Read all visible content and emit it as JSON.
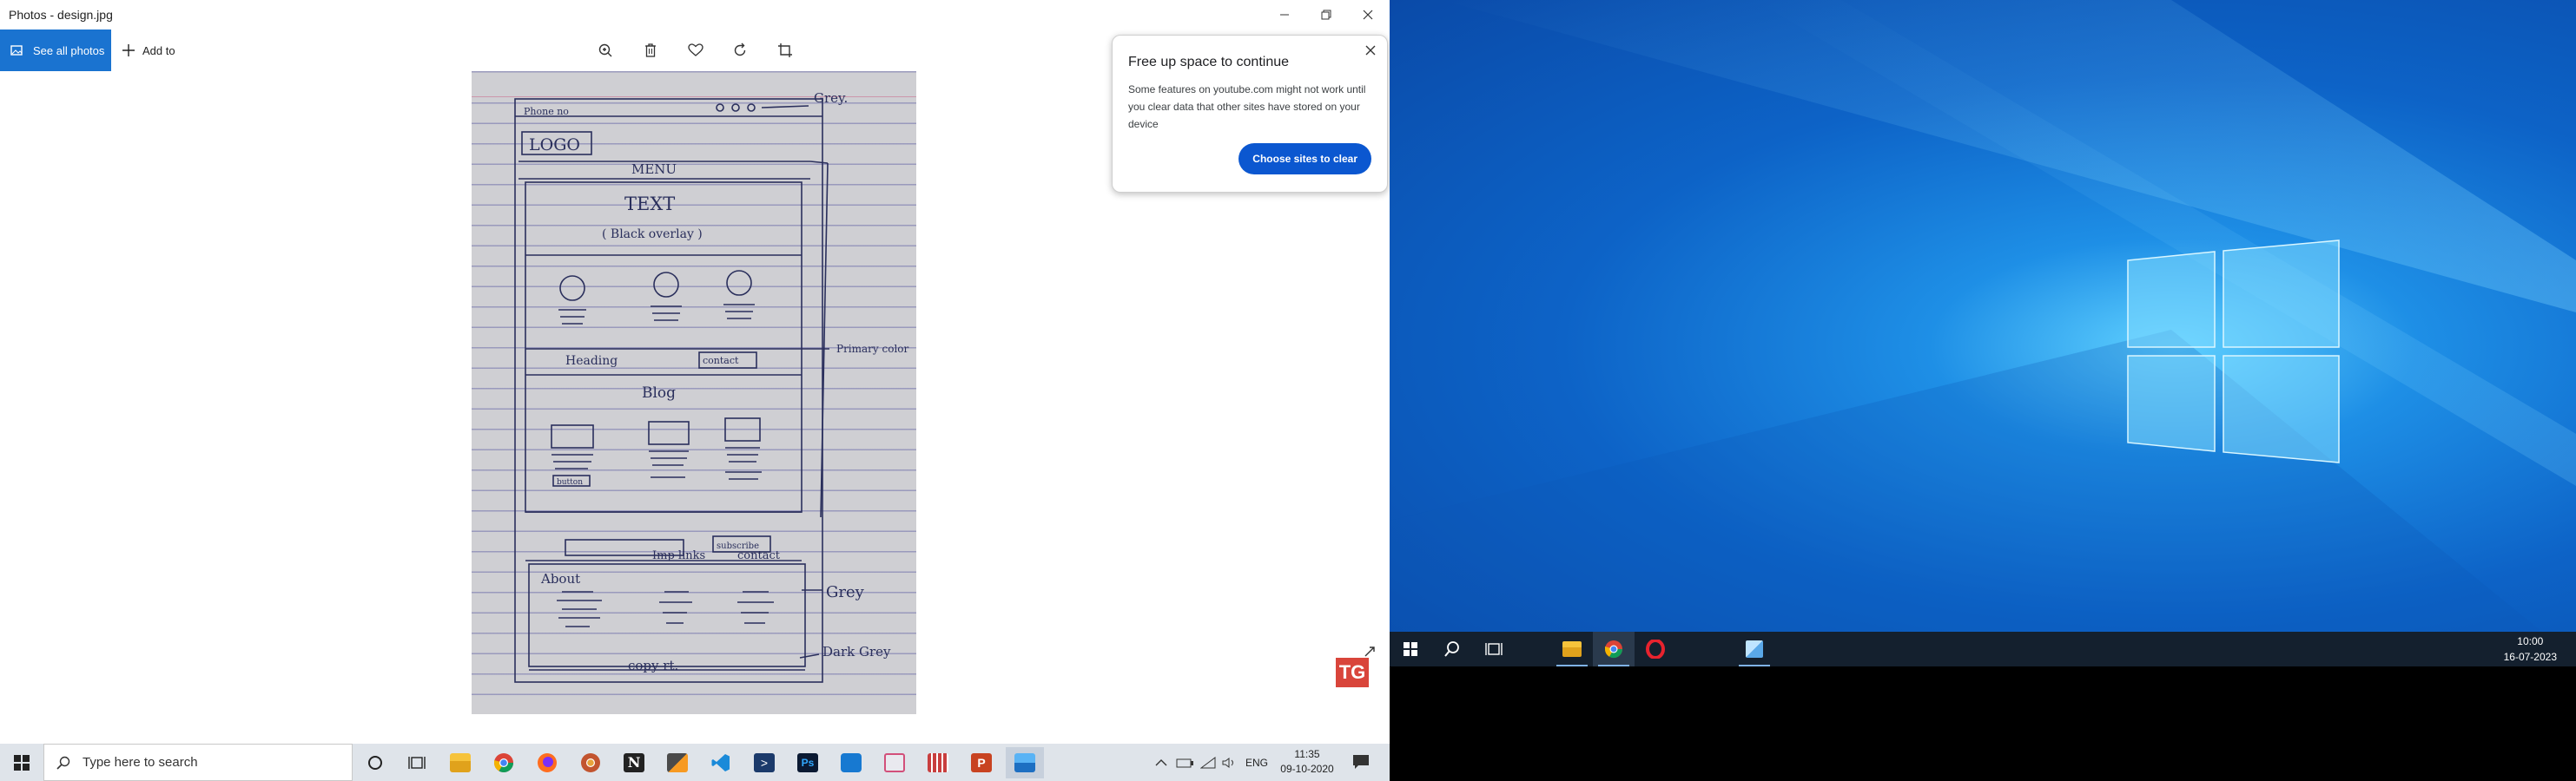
{
  "window": {
    "title": "Photos - design.jpg",
    "minimize_icon": "minimize-icon",
    "maximize_icon": "restore-icon",
    "close_icon": "close-icon"
  },
  "toolbar": {
    "see_all_photos": "See all photos",
    "add_to": "Add to",
    "tools": [
      "zoom-icon",
      "delete-icon",
      "favorite-icon",
      "rotate-icon",
      "crop-icon"
    ],
    "accent": "#1a73d0"
  },
  "photo": {
    "filename": "design.jpg",
    "sketch_labels": {
      "phone": "Phone no",
      "grey_top": "Grey.",
      "logo": "LOGO",
      "menu": "MENU",
      "text": "TEXT",
      "black_overlay": "( Black overlay )",
      "heading": "Heading",
      "contact": "contact",
      "primary_color": "Primary color",
      "blog": "Blog",
      "button": "button",
      "subscribe": "subscribe",
      "about": "About",
      "links": "Imp links",
      "contact_footer": "contact",
      "grey_footer": "Grey",
      "copyright": "copy rt.",
      "dark_grey": "Dark Grey"
    }
  },
  "popup": {
    "title": "Free up space to continue",
    "body": "Some features on youtube.com might not work until you clear data that other sites have stored on your device",
    "button": "Choose sites to clear",
    "button_color": "#0b57d0"
  },
  "badge": {
    "text": "TG"
  },
  "taskbar_left": {
    "search_placeholder": "Type here to search",
    "apps": [
      "cortana-icon",
      "task-view-icon",
      "file-explorer-icon",
      "chrome-icon",
      "firefox-icon",
      "chrome-canary-icon",
      "notion-icon",
      "sublime-text-icon",
      "vscode-icon",
      "powershell-icon",
      "photoshop-icon",
      "settings-icon",
      "snip-icon",
      "calendar-icon",
      "powerpoint-icon",
      "photos-icon"
    ],
    "language": "ENG",
    "time": "11:35",
    "date": "09-10-2020"
  },
  "taskbar_right": {
    "apps": [
      "start-icon",
      "search-icon",
      "task-view-icon",
      "file-explorer-icon",
      "chrome-icon",
      "opera-icon",
      "network-drive-icon"
    ],
    "time": "10:00",
    "date": "16-07-2023"
  }
}
